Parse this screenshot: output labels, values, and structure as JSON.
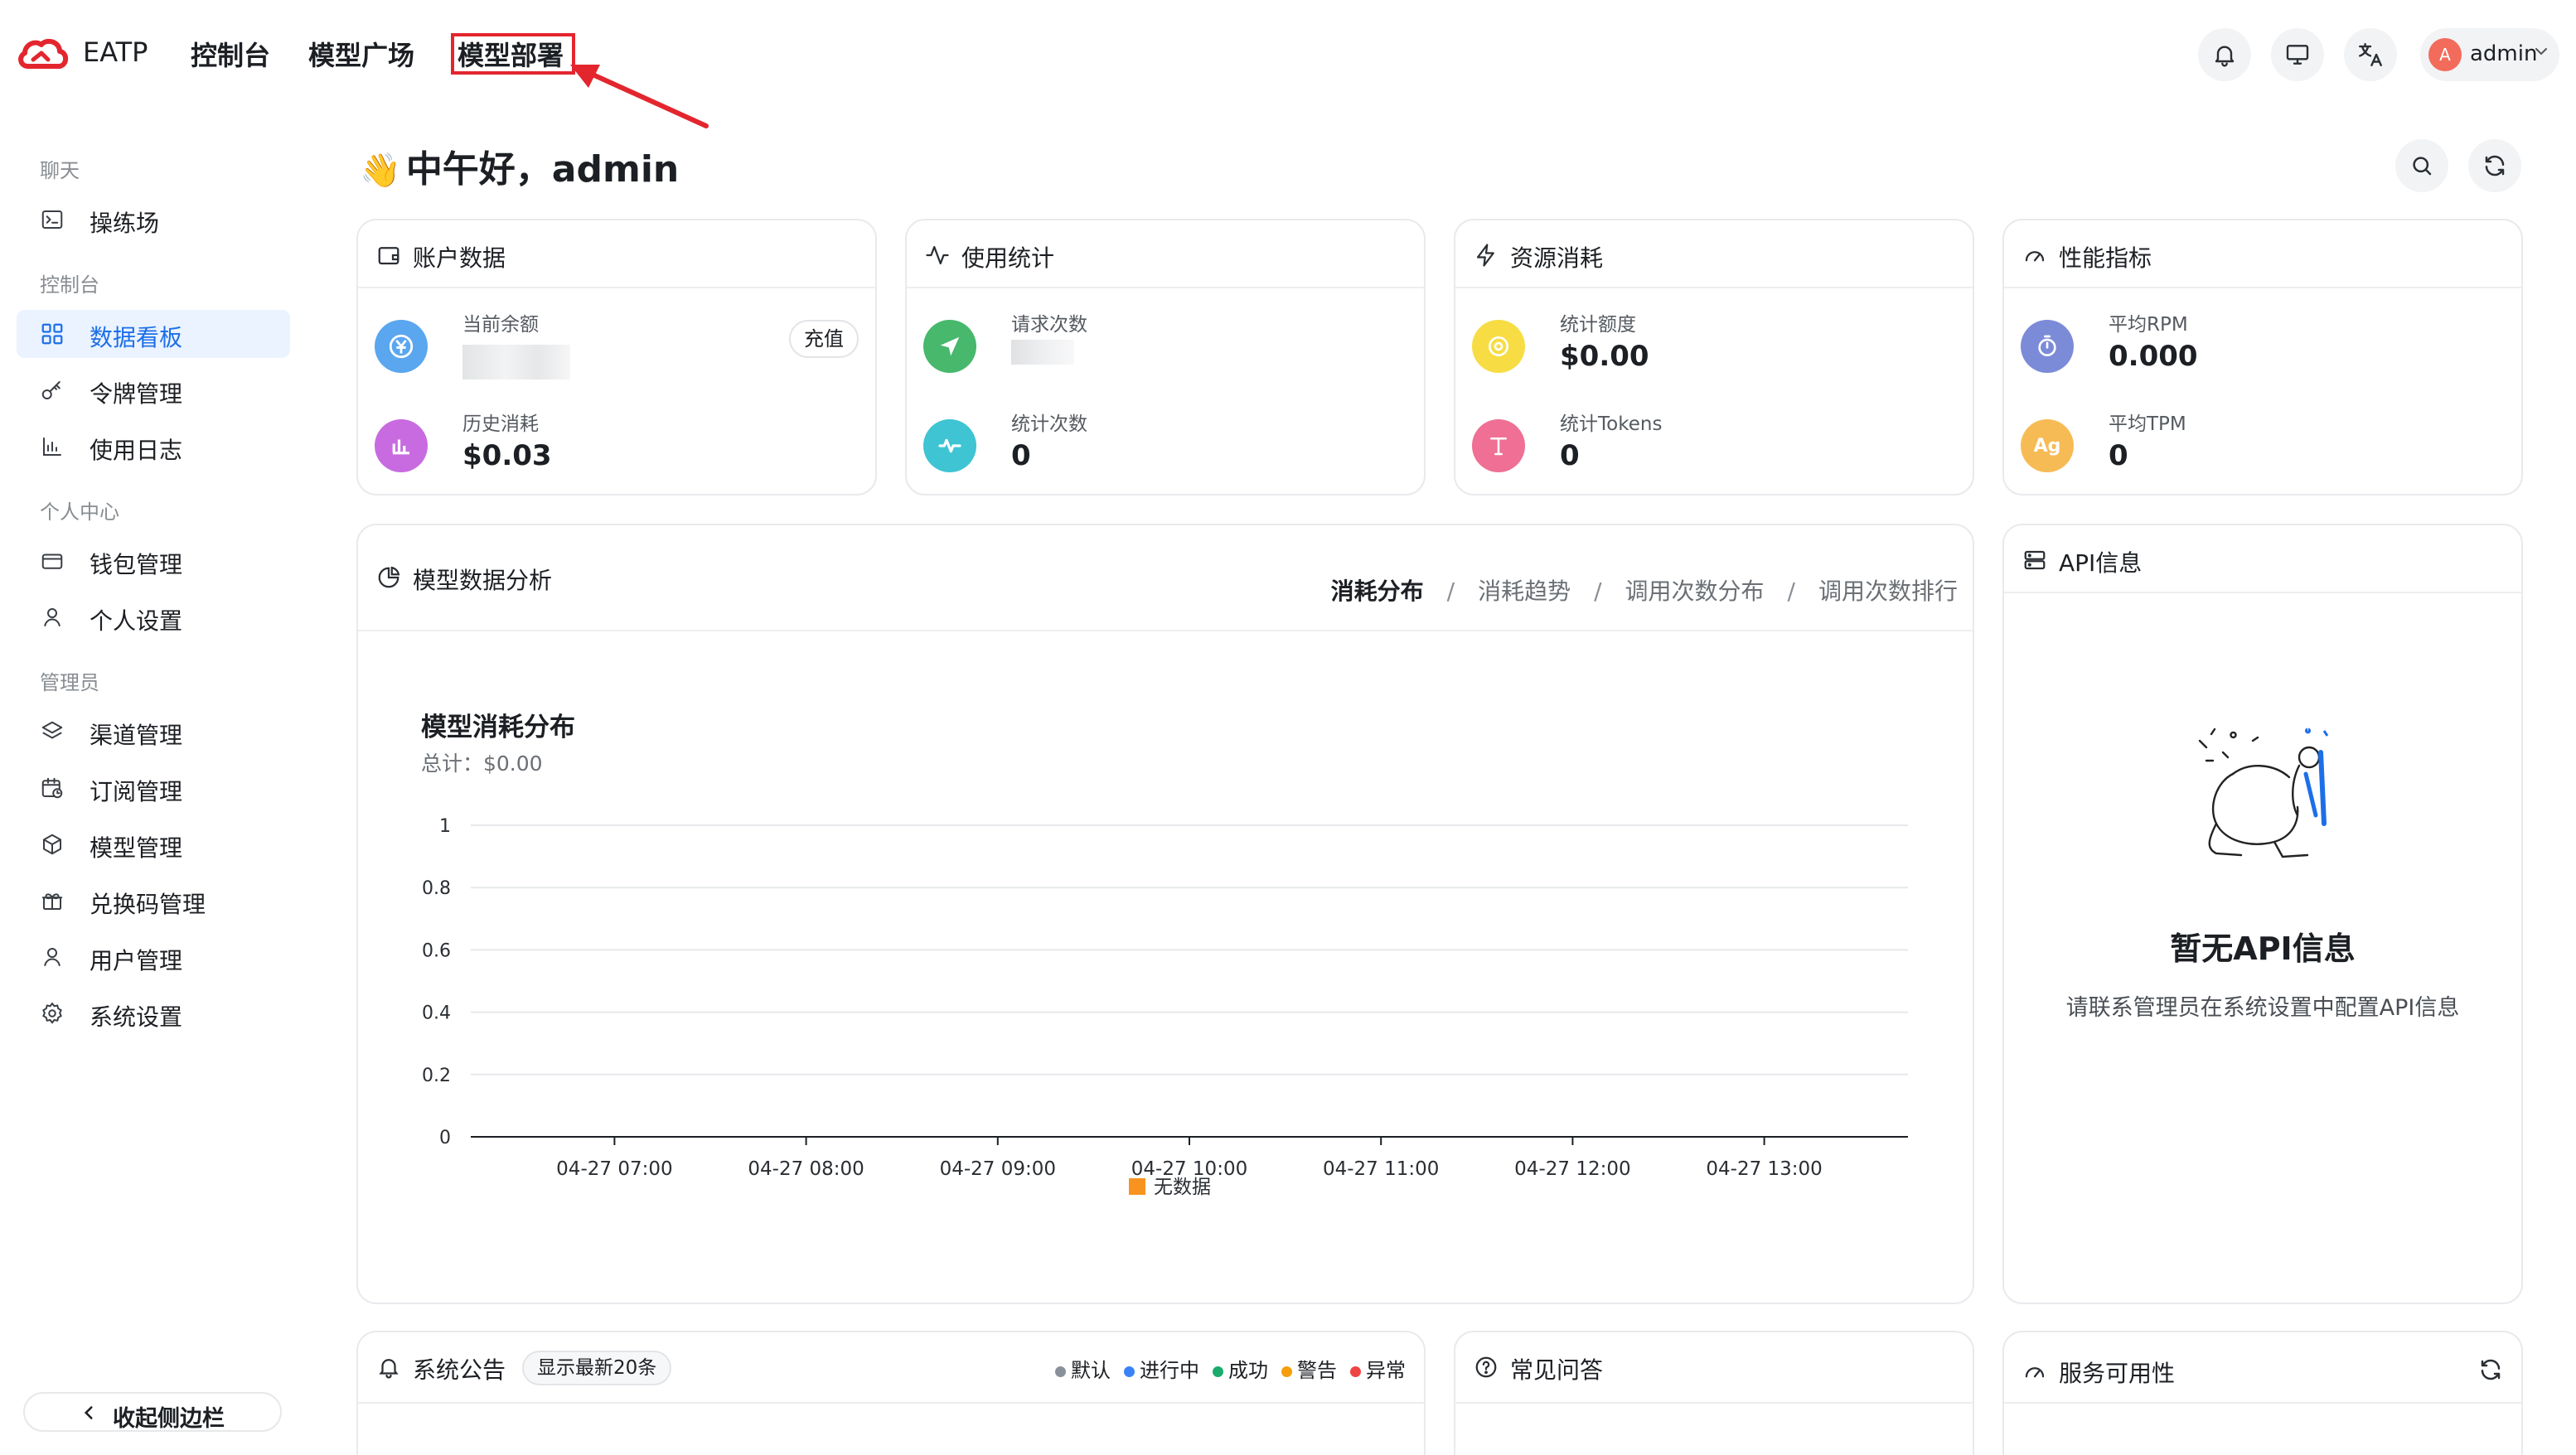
{
  "app": {
    "brand": "EATP"
  },
  "topnav": {
    "items": [
      {
        "label": "控制台"
      },
      {
        "label": "模型广场"
      },
      {
        "label": "模型部署"
      }
    ]
  },
  "header": {
    "user": {
      "avatar_letter": "A",
      "name": "admin"
    }
  },
  "sidebar": {
    "groups": [
      {
        "title": "聊天",
        "items": [
          {
            "label": "操练场"
          }
        ]
      },
      {
        "title": "控制台",
        "items": [
          {
            "label": "数据看板"
          },
          {
            "label": "令牌管理"
          },
          {
            "label": "使用日志"
          }
        ]
      },
      {
        "title": "个人中心",
        "items": [
          {
            "label": "钱包管理"
          },
          {
            "label": "个人设置"
          }
        ]
      },
      {
        "title": "管理员",
        "items": [
          {
            "label": "渠道管理"
          },
          {
            "label": "订阅管理"
          },
          {
            "label": "模型管理"
          },
          {
            "label": "兑换码管理"
          },
          {
            "label": "用户管理"
          },
          {
            "label": "系统设置"
          }
        ]
      }
    ],
    "collapse_label": "收起侧边栏"
  },
  "main": {
    "greeting": "中午好，admin",
    "cards": {
      "account": {
        "title": "账户数据",
        "balance_label": "当前余额",
        "recharge_label": "充值",
        "history_label": "历史消耗",
        "history_value": "$0.03"
      },
      "usage": {
        "title": "使用统计",
        "requests_label": "请求次数",
        "count_label": "统计次数",
        "count_value": "0"
      },
      "resource": {
        "title": "资源消耗",
        "quota_label": "统计额度",
        "quota_value": "$0.00",
        "tokens_label": "统计Tokens",
        "tokens_value": "0"
      },
      "performance": {
        "title": "性能指标",
        "rpm_label": "平均RPM",
        "rpm_value": "0.000",
        "tpm_label": "平均TPM",
        "tpm_value": "0"
      }
    },
    "analysis": {
      "title": "模型数据分析",
      "tabs": [
        "消耗分布",
        "消耗趋势",
        "调用次数分布",
        "调用次数排行"
      ],
      "active_tab": "消耗分布"
    },
    "api_info": {
      "title": "API信息",
      "empty_title": "暂无API信息",
      "empty_desc": "请联系管理员在系统设置中配置API信息"
    },
    "announcements": {
      "title": "系统公告",
      "tag": "显示最新20条",
      "legend": [
        {
          "label": "默认",
          "color": "#8a9099"
        },
        {
          "label": "进行中",
          "color": "#3b82f6"
        },
        {
          "label": "成功",
          "color": "#1aab6d"
        },
        {
          "label": "警告",
          "color": "#f59e0b"
        },
        {
          "label": "异常",
          "color": "#ef4444"
        }
      ]
    },
    "faq": {
      "title": "常见问答"
    },
    "availability": {
      "title": "服务可用性"
    }
  },
  "chart_data": {
    "type": "bar",
    "title": "模型消耗分布",
    "subtitle": "总计：$0.00",
    "categories": [
      "04-27 07:00",
      "04-27 08:00",
      "04-27 09:00",
      "04-27 10:00",
      "04-27 11:00",
      "04-27 12:00",
      "04-27 13:00"
    ],
    "series": [
      {
        "name": "无数据",
        "values": [
          0,
          0,
          0,
          0,
          0,
          0,
          0
        ],
        "color": "#f7931e"
      }
    ],
    "y_ticks": [
      "1",
      "0.8",
      "0.6",
      "0.4",
      "0.2",
      "0"
    ],
    "ylim": [
      0,
      1
    ],
    "grid": true,
    "legend": "bottom"
  },
  "colors": {
    "accent": "#1d6fe8",
    "highlight_box": "#e3262e"
  }
}
